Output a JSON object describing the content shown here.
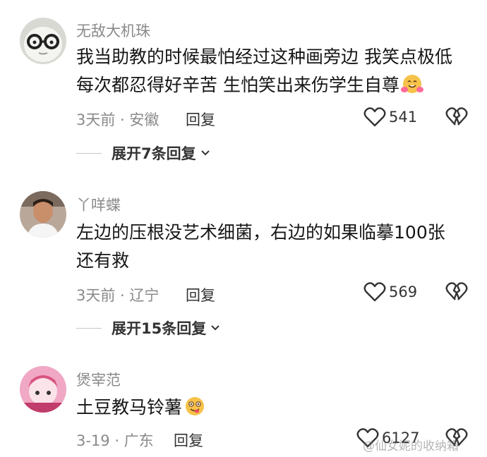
{
  "comments": [
    {
      "username": "无敌大机珠",
      "text_lines": [
        "我当助教的时候最怕经过这种画旁边 我笑点极低",
        "每次都忍得好辛苦 生怕笑出来伤学生自尊"
      ],
      "emoji": "hugging-face-emoji",
      "meta": "3天前 · 安徽",
      "reply_label": "回复",
      "like_count": "541",
      "expand_label": "展开7条回复",
      "avatar": "avatar-cartoon-glasses"
    },
    {
      "username": "丫咩蝶",
      "text_lines": [
        "左边的压根没艺术细菌，右边的如果临摹100张",
        "还有救"
      ],
      "meta": "3天前 · 辽宁",
      "reply_label": "回复",
      "like_count": "569",
      "expand_label": "展开15条回复",
      "avatar": "avatar-person-photo"
    },
    {
      "username": "煲宰范",
      "text_lines": [
        "土豆教马铃薯"
      ],
      "emoji": "yum-face-emoji",
      "meta": "3-19 · 广东",
      "reply_label": "回复",
      "like_count": "6127",
      "avatar": "avatar-pink-anime"
    }
  ],
  "watermark": "@仙女妮的收纳箱",
  "icons": {
    "like": "heart-outline-icon",
    "dislike": "broken-heart-icon",
    "expand": "chevron-down-icon"
  },
  "colors": {
    "username": "#8a8a8a",
    "text": "#161616",
    "meta": "#8a8a8a"
  }
}
